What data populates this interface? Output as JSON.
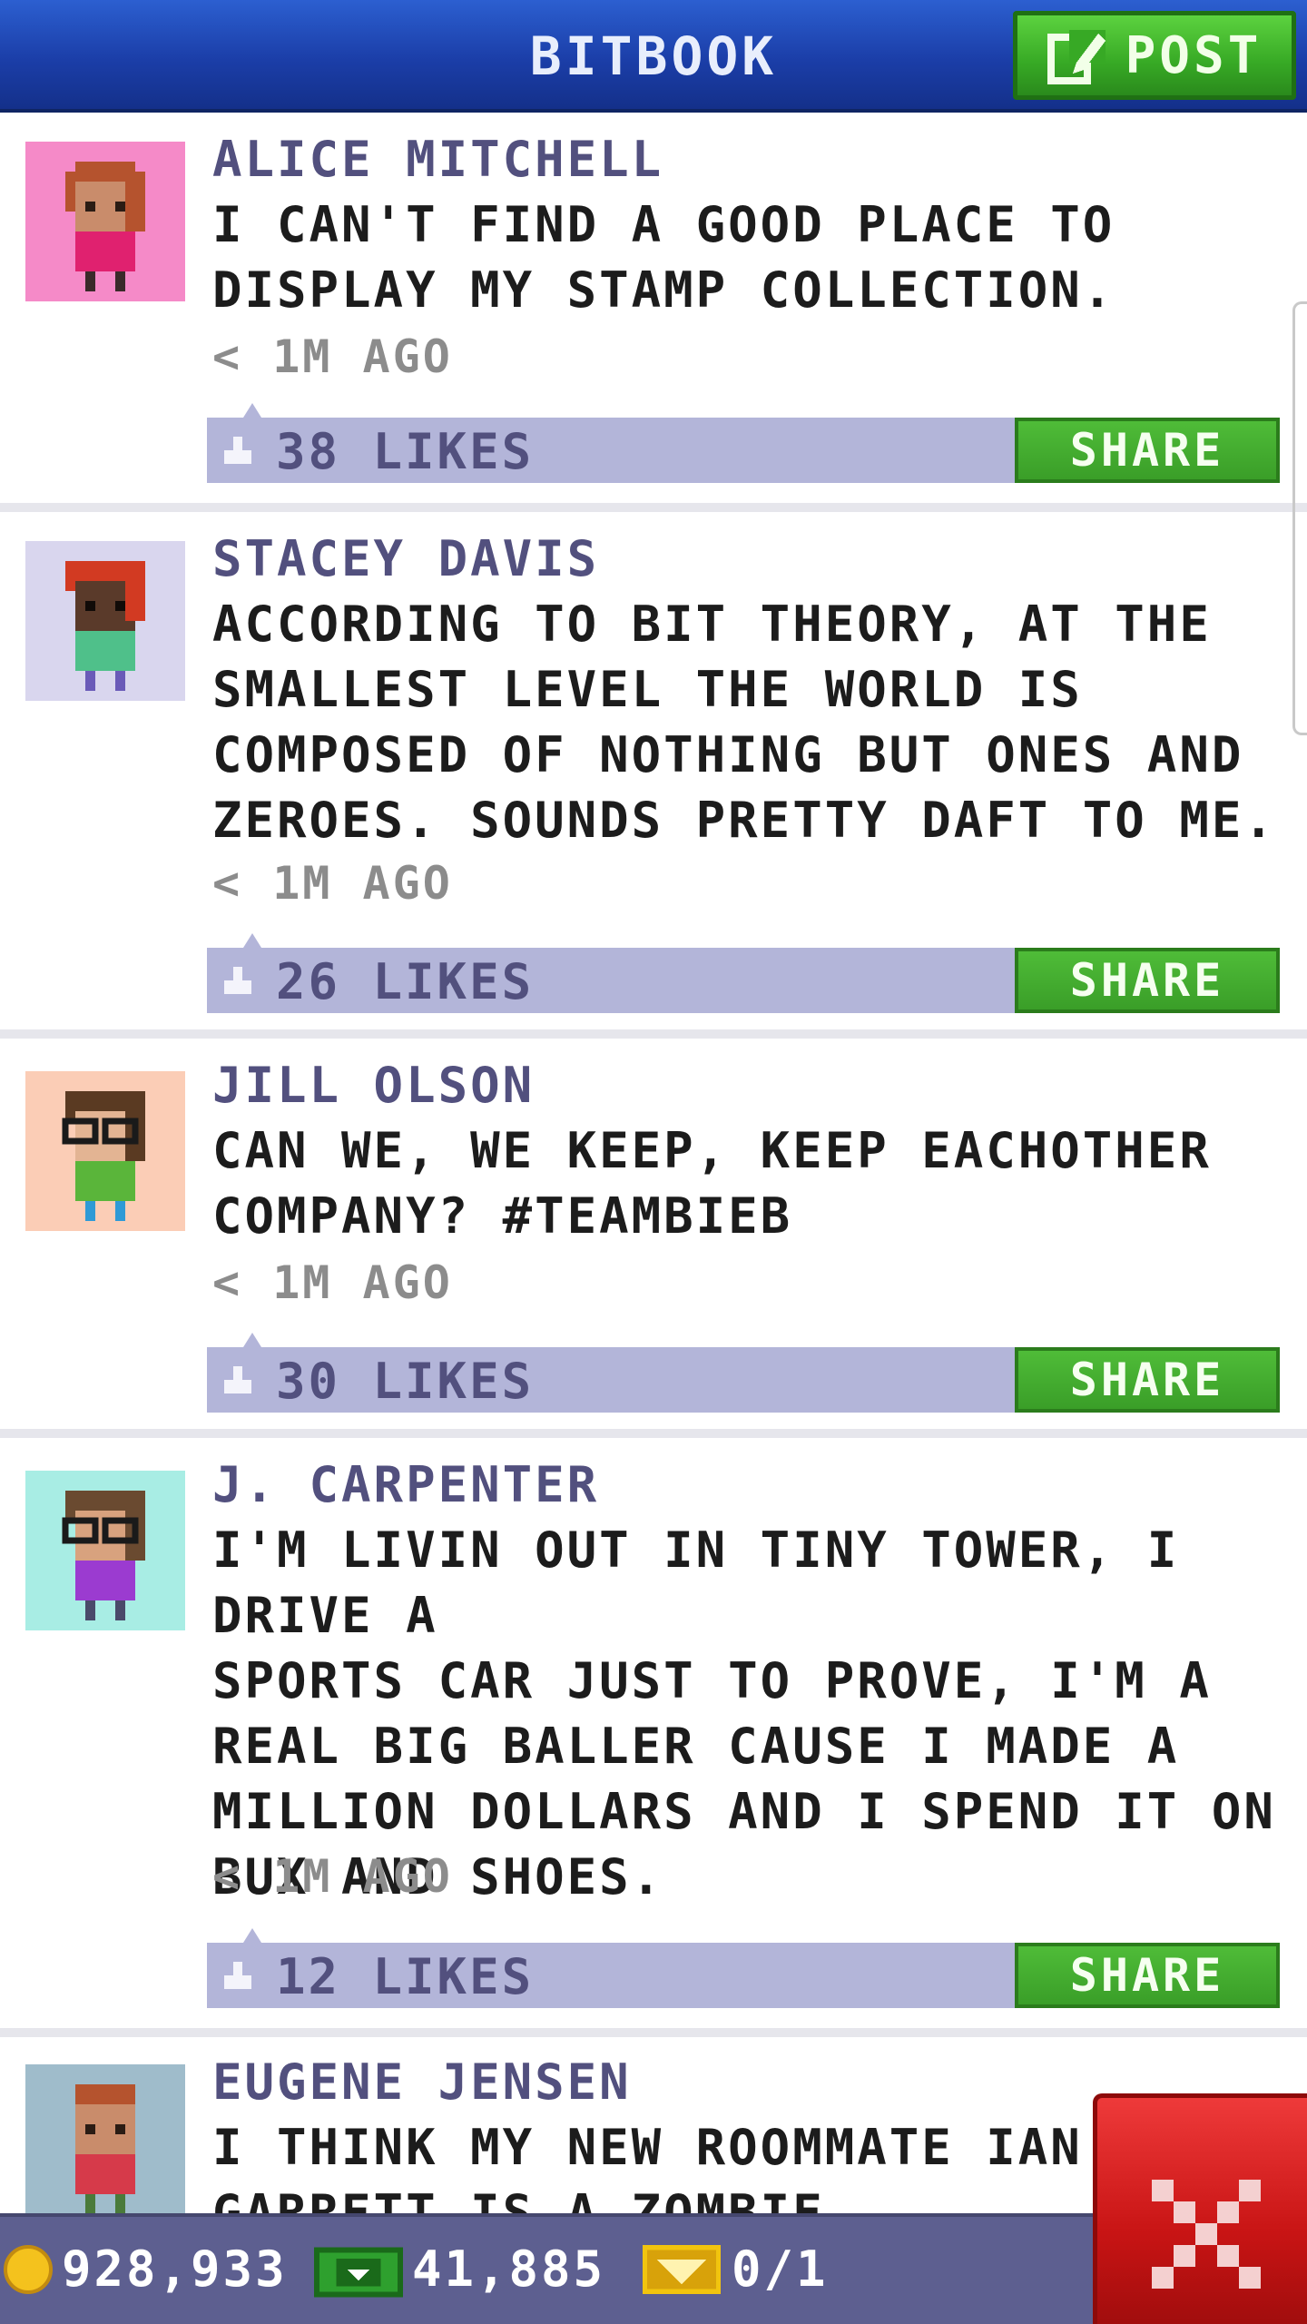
{
  "header": {
    "title": "BITBOOK",
    "post_label": "POST",
    "post_icon": "edit-icon"
  },
  "posts": [
    {
      "author": "ALICE MITCHELL",
      "text": "I CAN'T FIND A GOOD PLACE TO\nDISPLAY MY STAMP COLLECTION.",
      "time": "< 1M AGO",
      "likes": "38 LIKES",
      "share": "SHARE",
      "avatar_bg": "#f58ac8",
      "avatar": "girl-red-hair-pink-shirt"
    },
    {
      "author": "STACEY DAVIS",
      "text": "ACCORDING TO BIT THEORY, AT THE\nSMALLEST LEVEL THE WORLD IS\nCOMPOSED OF NOTHING BUT ONES AND\nZEROES. SOUNDS PRETTY DAFT TO ME.",
      "time": "< 1M AGO",
      "likes": "26 LIKES",
      "share": "SHARE",
      "avatar_bg": "#d9d6ee",
      "avatar": "woman-red-hair-green-shirt"
    },
    {
      "author": "JILL OLSON",
      "text": "CAN WE, WE KEEP, KEEP EACHOTHER\nCOMPANY? #TEAMBIEB",
      "time": "< 1M AGO",
      "likes": "30 LIKES",
      "share": "SHARE",
      "avatar_bg": "#fbcdb6",
      "avatar": "girl-glasses-green-shirt"
    },
    {
      "author": "J. CARPENTER",
      "text": "I'M LIVIN OUT IN TINY TOWER, I DRIVE A\nSPORTS CAR JUST TO PROVE, I'M A\nREAL BIG BALLER CAUSE I MADE A\nMILLION DOLLARS AND I SPEND IT ON\nBUX AND SHOES.",
      "time": "< 1M AGO",
      "likes": "12 LIKES",
      "share": "SHARE",
      "avatar_bg": "#a8ede4",
      "avatar": "woman-glasses-purple-shirt"
    },
    {
      "author": "EUGENE JENSEN",
      "text": "I THINK MY NEW ROOMMATE IAN\nGARRETT IS A ZOMBIE.",
      "avatar_bg": "#9fbccb",
      "avatar": "man-red-shirt"
    }
  ],
  "bottom_bar": {
    "coins": "928,933",
    "bux": "41,885",
    "tickets": "0/1"
  },
  "colors": {
    "header_blue": "#1b3ea8",
    "share_green": "#3a9e28",
    "likes_bar": "#b3b5d9",
    "author_purple": "#52507e",
    "close_red": "#c81414"
  }
}
